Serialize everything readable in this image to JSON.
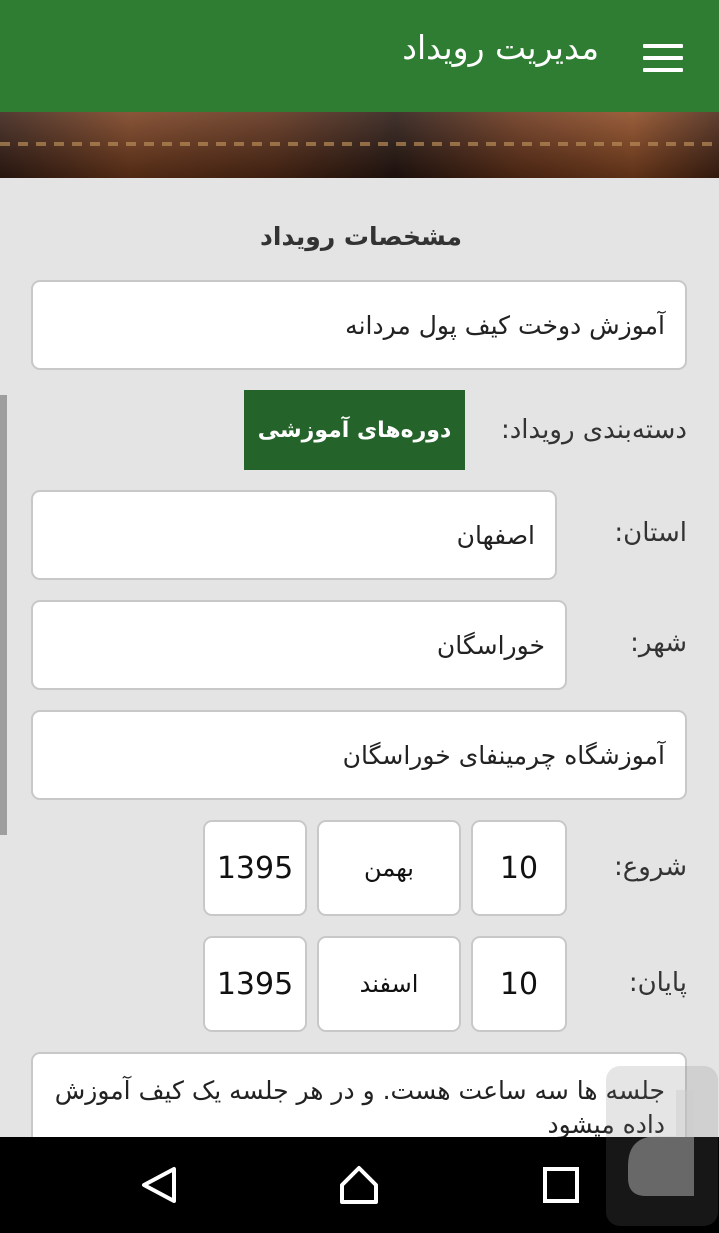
{
  "appbar": {
    "title": "مدیریت رویداد",
    "menu_icon": "hamburger-menu-icon",
    "color": "#2e7d32"
  },
  "section": {
    "title": "مشخصات رویداد"
  },
  "form": {
    "event_name": "آموزش دوخت کیف پول مردانه",
    "category_label": "دسته‌بندی رویداد:",
    "category_value": "دوره‌های آموزشی",
    "province_label": "استان:",
    "province_value": "اصفهان",
    "city_label": "شهر:",
    "city_value": "خوراسگان",
    "venue": "آموزشگاه چرمینفای خوراسگان",
    "start": {
      "label": "شروع:",
      "day": "10",
      "month": "بهمن",
      "year": "1395"
    },
    "end": {
      "label": "پایان:",
      "day": "10",
      "month": "اسفند",
      "year": "1395"
    },
    "description": "جلسه ها سه ساعت هست. و در هر جلسه یک کیف آموزش داده میشود"
  },
  "navbar": {
    "back_icon": "back-triangle-icon",
    "home_icon": "home-icon",
    "recents_icon": "recents-square-icon"
  },
  "colors": {
    "accent": "#2e7d32",
    "category_button": "#24632a",
    "background": "#e4e4e4"
  }
}
